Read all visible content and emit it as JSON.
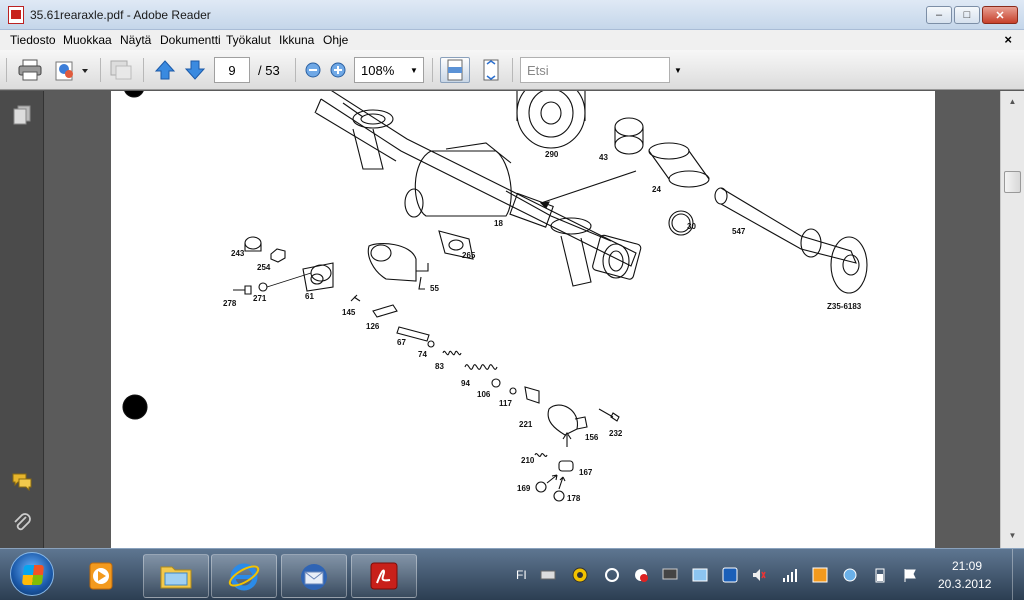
{
  "window": {
    "title": "35.61rearaxle.pdf - Adobe Reader",
    "buttons": {
      "minimize": "–",
      "maximize": "□",
      "close": "✕"
    }
  },
  "menu": {
    "items": [
      "Tiedosto",
      "Muokkaa",
      "Näytä",
      "Dokumentti",
      "Työkalut",
      "Ikkuna",
      "Ohje"
    ],
    "close": "×"
  },
  "toolbar": {
    "page_current": "9",
    "page_total": "/ 53",
    "zoom": "108%",
    "search_placeholder": "Etsi"
  },
  "drawing": {
    "part_labels": [
      "290",
      "43",
      "24",
      "30",
      "547",
      "18",
      "243",
      "254",
      "265",
      "278",
      "271",
      "61",
      "55",
      "145",
      "126",
      "67",
      "74",
      "83",
      "94",
      "106",
      "117",
      "221",
      "156",
      "232",
      "210",
      "167",
      "169",
      "178"
    ],
    "reference": "Z35-6183"
  },
  "taskbar": {
    "language": "FI",
    "time": "21:09",
    "date": "20.3.2012",
    "apps": [
      "media-player",
      "file-explorer",
      "internet-explorer",
      "thunderbird",
      "adobe-reader"
    ]
  }
}
